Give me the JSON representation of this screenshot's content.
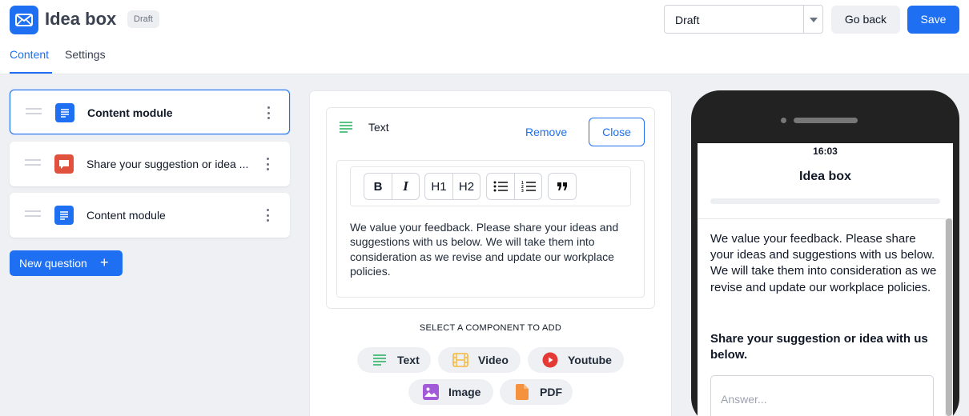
{
  "header": {
    "title": "Idea box",
    "badge": "Draft",
    "status_select": "Draft",
    "go_back": "Go back",
    "save": "Save"
  },
  "tabs": [
    {
      "label": "Content",
      "active": true
    },
    {
      "label": "Settings",
      "active": false
    }
  ],
  "modules": [
    {
      "label": "Content module",
      "icon": "document-icon",
      "color": "#1e6ff1",
      "active": true
    },
    {
      "label": "Share your suggestion or idea ...",
      "icon": "chat-icon",
      "color": "#e0523d",
      "active": false
    },
    {
      "label": "Content module",
      "icon": "document-icon",
      "color": "#1e6ff1",
      "active": false
    }
  ],
  "new_question": "New question",
  "editor": {
    "block_title": "Text",
    "remove": "Remove",
    "close": "Close",
    "toolbar": [
      "B",
      "I",
      "H1",
      "H2",
      "bullet-list",
      "numbered-list",
      "quote"
    ],
    "body": "We value your feedback. Please share your ideas and suggestions with us below. We will take them into consideration as we revise and update our workplace policies."
  },
  "components": {
    "label": "SELECT A COMPONENT TO ADD",
    "items": [
      {
        "label": "Text",
        "icon": "text-lines-icon",
        "color": "#22b05a"
      },
      {
        "label": "Video",
        "icon": "film-icon",
        "color": "#f5b83d"
      },
      {
        "label": "Youtube",
        "icon": "youtube-icon",
        "color": "#e53935"
      },
      {
        "label": "Image",
        "icon": "image-icon",
        "color": "#a35ad8"
      },
      {
        "label": "PDF",
        "icon": "pdf-file-icon",
        "color": "#f5923d"
      }
    ]
  },
  "preview": {
    "time": "16:03",
    "title": "Idea box",
    "body": "We value your feedback. Please share your ideas and suggestions with us below. We will take them into consideration as we revise and update our workplace policies.",
    "question": "Share your suggestion or idea with us below.",
    "answer_placeholder": "Answer..."
  },
  "colors": {
    "accent": "#1e6ff1",
    "workspace_bg": "#eef0f4",
    "phone_frame": "#222222"
  }
}
